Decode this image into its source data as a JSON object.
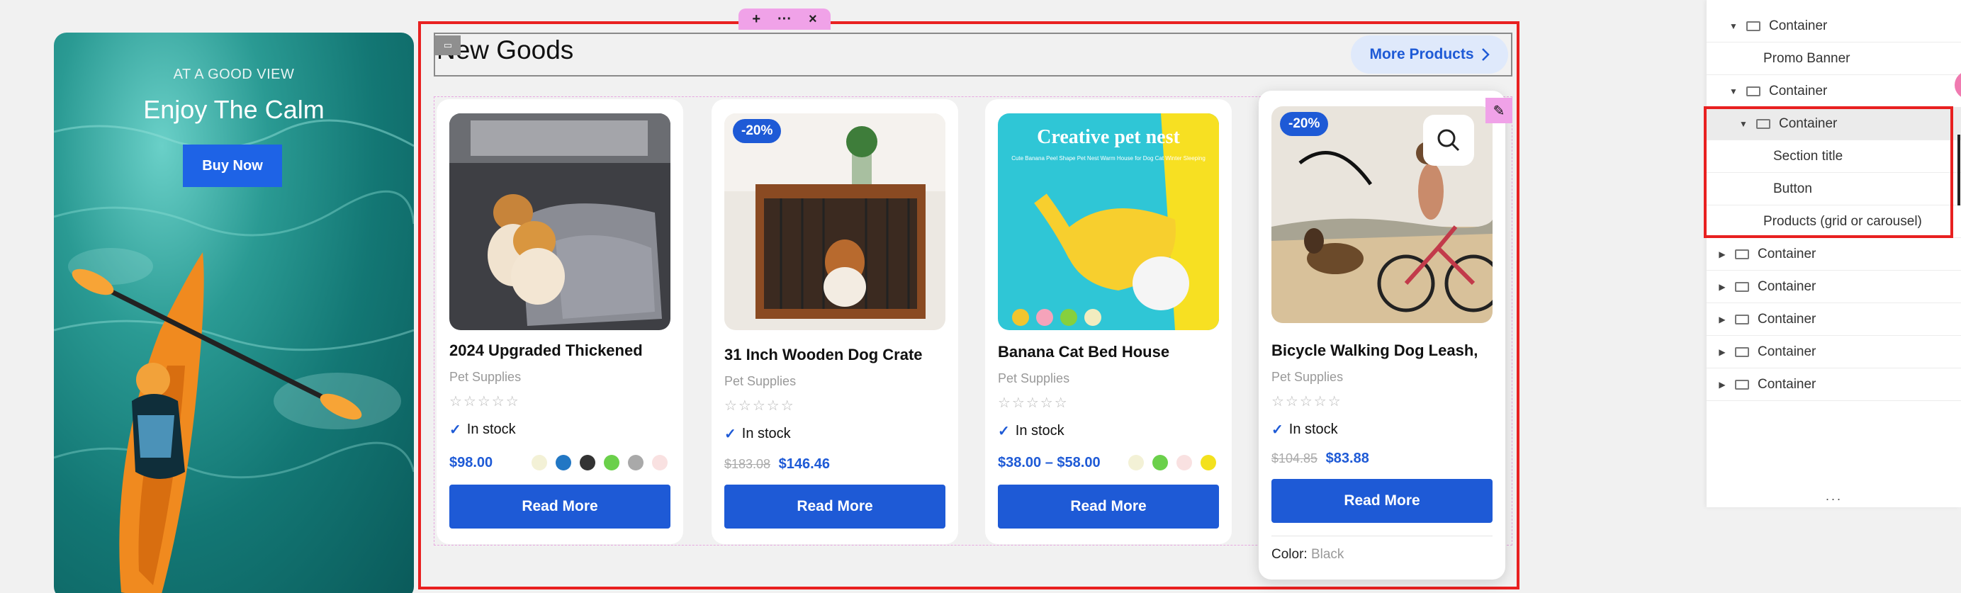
{
  "promo": {
    "eyebrow": "AT A GOOD VIEW",
    "title": "Enjoy The Calm",
    "button": "Buy Now"
  },
  "editor_toolbar": {
    "add": "+",
    "more": "···",
    "close": "×"
  },
  "section": {
    "title": "New Goods",
    "more_button": "More Products"
  },
  "products": [
    {
      "name": "2024 Upgraded Thickened",
      "category": "Pet Supplies",
      "stars": "☆☆☆☆☆",
      "stock": "In stock",
      "price": "$98.00",
      "swatches": [
        "#f3f1d6",
        "#2277c4",
        "#333333",
        "#6bd04b",
        "#a9a9a9",
        "#f9e1e1"
      ],
      "button": "Read More"
    },
    {
      "badge": "-20%",
      "name": "31 Inch Wooden Dog Crate",
      "category": "Pet Supplies",
      "stars": "☆☆☆☆☆",
      "stock": "In stock",
      "old_price": "$183.08",
      "price": "$146.46",
      "button": "Read More"
    },
    {
      "name": "Banana Cat Bed House",
      "category": "Pet Supplies",
      "stars": "☆☆☆☆☆",
      "stock": "In stock",
      "price": "$38.00 – $58.00",
      "swatches": [
        "#f3f1d6",
        "#6bd04b",
        "#f9e1e1",
        "#f3e11e"
      ],
      "button": "Read More",
      "image_text": {
        "headline": "Creative pet nest",
        "sub": "Cute Banana Peel Shape Pet Nest Warm House for Dog Cat Winter Sleeping"
      }
    },
    {
      "badge": "-20%",
      "name": "Bicycle Walking Dog Leash,",
      "category": "Pet Supplies",
      "stars": "☆☆☆☆☆",
      "stock": "In stock",
      "old_price": "$104.85",
      "price": "$83.88",
      "button": "Read More",
      "color_label": "Color:",
      "color_value": "Black"
    }
  ],
  "navigator": {
    "items": [
      {
        "label": "Container",
        "indent": 1,
        "expanded": true
      },
      {
        "label": "Promo Banner",
        "indent": 2
      },
      {
        "label": "Container",
        "indent": 1,
        "expanded": true
      },
      {
        "label": "Container",
        "indent": 2,
        "expanded": true,
        "selected": true
      },
      {
        "label": "Section title",
        "indent": 3
      },
      {
        "label": "Button",
        "indent": 3
      },
      {
        "label": "Products (grid or carousel)",
        "indent": 2
      },
      {
        "label": "Container",
        "indent": 0
      },
      {
        "label": "Container",
        "indent": 0
      },
      {
        "label": "Container",
        "indent": 0
      },
      {
        "label": "Container",
        "indent": 0
      },
      {
        "label": "Container",
        "indent": 0
      }
    ],
    "footer": "···"
  },
  "colors": {
    "accent": "#1e5ad6",
    "selection": "#e82020",
    "editor_pink": "#f0a2e8"
  }
}
